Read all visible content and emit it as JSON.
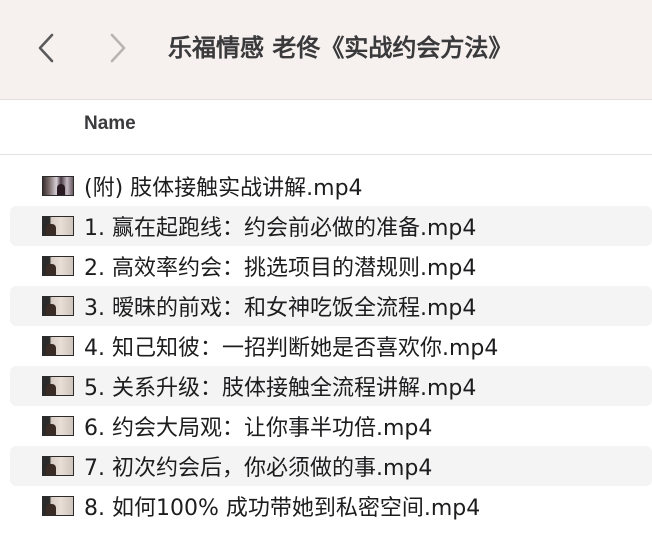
{
  "window": {
    "title": "乐福情感 老佟《实战约会方法》"
  },
  "navigation": {
    "back_icon": "chevron-left-icon",
    "forward_icon": "chevron-right-icon"
  },
  "columns": {
    "name_header": "Name"
  },
  "files": [
    {
      "name": "(附) 肢体接触实战讲解.mp4"
    },
    {
      "name": "1. 赢在起跑线：约会前必做的准备.mp4"
    },
    {
      "name": "2. 高效率约会：挑选项目的潜规则.mp4"
    },
    {
      "name": "3. 暧昧的前戏：和女神吃饭全流程.mp4"
    },
    {
      "name": "4. 知己知彼：一招判断她是否喜欢你.mp4"
    },
    {
      "name": "5. 关系升级：肢体接触全流程讲解.mp4"
    },
    {
      "name": "6. 约会大局观：让你事半功倍.mp4"
    },
    {
      "name": "7. 初次约会后，你必须做的事.mp4"
    },
    {
      "name": "8. 如何100% 成功带她到私密空间.mp4"
    }
  ],
  "colors": {
    "toolbar_bg": "#f6f1ee",
    "row_alt_bg": "#f4f4f4",
    "text": "#1d1d1f"
  }
}
